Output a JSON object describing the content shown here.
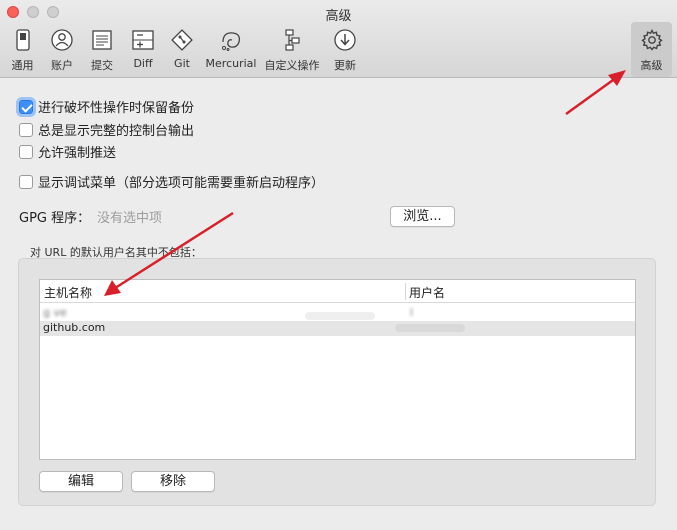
{
  "window": {
    "title": "高级"
  },
  "toolbar": {
    "items": [
      {
        "label": "通用",
        "icon": "switch-icon"
      },
      {
        "label": "账户",
        "icon": "person-icon"
      },
      {
        "label": "提交",
        "icon": "document-icon"
      },
      {
        "label": "Diff",
        "icon": "diff-icon"
      },
      {
        "label": "Git",
        "icon": "git-icon"
      },
      {
        "label": "Mercurial",
        "icon": "mercurial-icon"
      },
      {
        "label": "自定义操作",
        "icon": "custom-actions-icon"
      },
      {
        "label": "更新",
        "icon": "download-icon"
      },
      {
        "label": "高级",
        "icon": "gear-icon",
        "active": true
      }
    ]
  },
  "options": {
    "keep_backup": {
      "label": "进行破坏性操作时保留备份",
      "checked": true
    },
    "show_console": {
      "label": "总是显示完整的控制台输出",
      "checked": false
    },
    "force_push": {
      "label": "允许强制推送",
      "checked": false
    },
    "debug_menu": {
      "label": "显示调试菜单（部分选项可能需要重新启动程序）",
      "checked": false
    }
  },
  "gpg": {
    "label": "GPG 程序：",
    "value": "没有选中项",
    "browse_label": "浏览..."
  },
  "url_exclusions": {
    "title": "对 URL 的默认用户名其中不包括：",
    "columns": [
      "主机名称",
      "用户名"
    ],
    "rows": [
      {
        "host": "g        ve",
        "user": "l"
      },
      {
        "host": "github.com",
        "user": ""
      }
    ],
    "edit_label": "编辑",
    "remove_label": "移除"
  },
  "colors": {
    "accent": "#3b8ff6",
    "annotation_arrow": "#d9202a"
  }
}
